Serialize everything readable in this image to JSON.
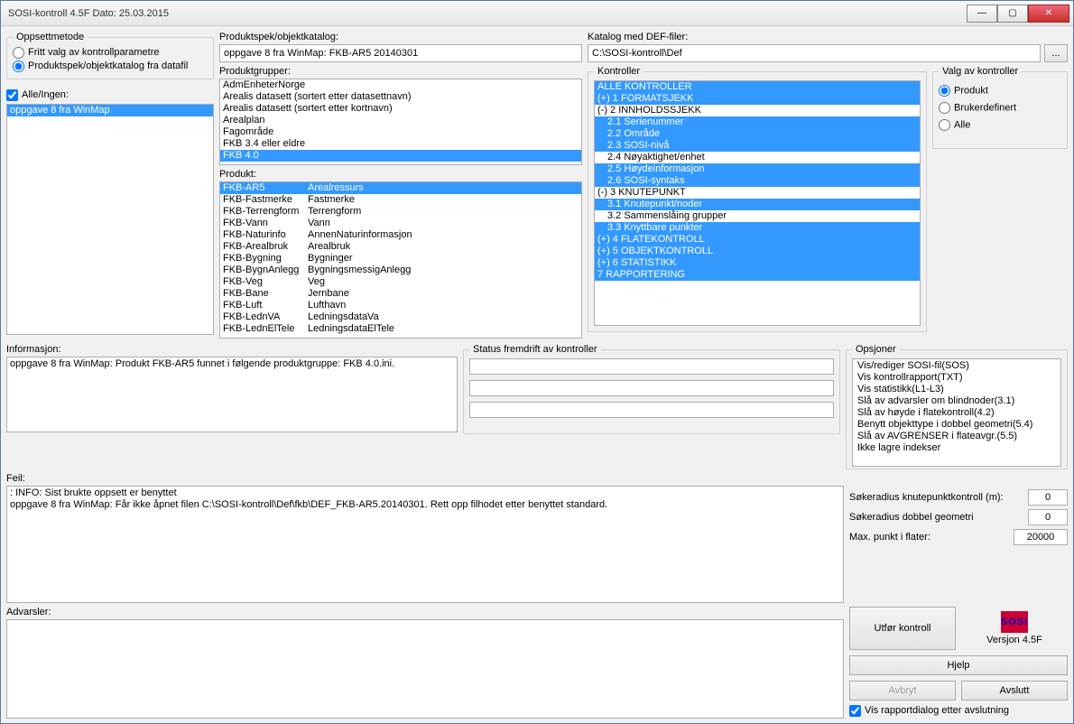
{
  "titlebar": "SOSI-kontroll 4.5F   Dato: 25.03.2015",
  "oppsett": {
    "legend": "Oppsettmetode",
    "r1": "Fritt valg av kontrollparametre",
    "r2": "Produktspek/objektkatalog fra datafil"
  },
  "alleIngen": {
    "label": "Alle/Ingen:",
    "items": [
      "oppgave 8 fra WinMap"
    ]
  },
  "ps": {
    "label": "Produktspek/objektkatalog:",
    "value": "oppgave 8 fra WinMap: FKB-AR5 20140301",
    "grupper_label": "Produktgrupper:",
    "grupper": [
      {
        "t": "AdmEnheterNorge",
        "sel": false
      },
      {
        "t": "Arealis datasett (sortert etter datasettnavn)",
        "sel": false
      },
      {
        "t": "Arealis datasett (sortert etter kortnavn)",
        "sel": false
      },
      {
        "t": "Arealplan",
        "sel": false
      },
      {
        "t": "Fagområde",
        "sel": false
      },
      {
        "t": "FKB 3.4 eller eldre",
        "sel": false
      },
      {
        "t": "FKB 4.0",
        "sel": true
      }
    ],
    "produkt_label": "Produkt:",
    "produkt": [
      {
        "a": "FKB-AR5",
        "b": "Arealressurs",
        "sel": true
      },
      {
        "a": "FKB-Fastmerke",
        "b": "Fastmerke",
        "sel": false
      },
      {
        "a": "FKB-Terrengform",
        "b": "Terrengform",
        "sel": false
      },
      {
        "a": "FKB-Vann",
        "b": "Vann",
        "sel": false
      },
      {
        "a": "FKB-Naturinfo",
        "b": "AnnenNaturinformasjon",
        "sel": false
      },
      {
        "a": "FKB-Arealbruk",
        "b": "Arealbruk",
        "sel": false
      },
      {
        "a": "FKB-Bygning",
        "b": "Bygninger",
        "sel": false
      },
      {
        "a": "FKB-BygnAnlegg",
        "b": "BygningsmessigAnlegg",
        "sel": false
      },
      {
        "a": "FKB-Veg",
        "b": "Veg",
        "sel": false
      },
      {
        "a": "FKB-Bane",
        "b": "Jernbane",
        "sel": false
      },
      {
        "a": "FKB-Luft",
        "b": "Lufthavn",
        "sel": false
      },
      {
        "a": "FKB-LednVA",
        "b": "LedningsdataVa",
        "sel": false
      },
      {
        "a": "FKB-LednElTele",
        "b": "LedningsdataElTele",
        "sel": false
      }
    ]
  },
  "def": {
    "label": "Katalog med DEF-filer:",
    "value": "C:\\SOSI-kontroll\\Def",
    "browse": "..."
  },
  "kontroller": {
    "legend": "Kontroller",
    "items": [
      {
        "t": "ALLE KONTROLLER",
        "sel": true,
        "ind": 0
      },
      {
        "t": "(+) 1 FORMATSJEKK",
        "sel": true,
        "ind": 0
      },
      {
        "t": "(-) 2 INNHOLDSSJEKK",
        "sel": false,
        "ind": 0
      },
      {
        "t": "2.1 Serienummer",
        "sel": true,
        "ind": 1
      },
      {
        "t": "2.2 Område",
        "sel": true,
        "ind": 1
      },
      {
        "t": "2.3 SOSI-nivå",
        "sel": true,
        "ind": 1
      },
      {
        "t": "2.4 Nøyaktighet/enhet",
        "sel": false,
        "ind": 1
      },
      {
        "t": "2.5 Høydeinformasjon",
        "sel": true,
        "ind": 1
      },
      {
        "t": "2.6 SOSI-syntaks",
        "sel": true,
        "ind": 1
      },
      {
        "t": "(-) 3 KNUTEPUNKT",
        "sel": false,
        "ind": 0
      },
      {
        "t": "3.1 Knutepunkt/noder",
        "sel": true,
        "ind": 1
      },
      {
        "t": "3.2 Sammenslåing grupper",
        "sel": false,
        "ind": 1
      },
      {
        "t": "3.3 Knyttbare punkter",
        "sel": true,
        "ind": 1
      },
      {
        "t": "(+) 4 FLATEKONTROLL",
        "sel": true,
        "ind": 0
      },
      {
        "t": "(+) 5 OBJEKTKONTROLL",
        "sel": true,
        "ind": 0
      },
      {
        "t": "(+) 6 STATISTIKK",
        "sel": true,
        "ind": 0
      },
      {
        "t": "7 RAPPORTERING",
        "sel": true,
        "ind": 0
      }
    ]
  },
  "valg": {
    "legend": "Valg av kontroller",
    "r1": "Produkt",
    "r2": "Brukerdefinert",
    "r3": "Alle"
  },
  "info": {
    "label": "Informasjon:",
    "text": "oppgave 8 fra WinMap: Produkt FKB-AR5 funnet i følgende produktgruppe: FKB 4.0.ini."
  },
  "status": {
    "legend": "Status fremdrift av kontroller"
  },
  "opsjoner": {
    "legend": "Opsjoner",
    "items": [
      "Vis/rediger SOSI-fil(SOS)",
      "Vis kontrollrapport(TXT)",
      "Vis statistikk(L1-L3)",
      "Slå av advarsler om blindnoder(3.1)",
      "Slå av høyde i flatekontroll(4.2)",
      "Benytt objekttype i dobbel geometri(5.4)",
      "Slå av AVGRENSER i flateavgr.(5.5)",
      "Ikke lagre indekser"
    ]
  },
  "feil": {
    "label": "Feil:",
    "l1": ": INFO: Sist brukte oppsett er benyttet",
    "l2": "oppgave 8 fra WinMap: Får ikke åpnet filen C:\\SOSI-kontroll\\Def\\fkb\\DEF_FKB-AR5.20140301. Rett opp filhodet etter benyttet standard."
  },
  "adv": {
    "label": "Advarsler:"
  },
  "nums": {
    "l1": "Søkeradius knutepunktkontroll (m):",
    "v1": "0",
    "l2": "Søkeradius dobbel geometri",
    "v2": "0",
    "l3": "Max. punkt i flater:",
    "v3": "20000"
  },
  "btns": {
    "utfor": "Utfør kontroll",
    "versjon": "Versjon 4.5F",
    "hjelp": "Hjelp",
    "avbryt": "Avbryt",
    "avslutt": "Avslutt",
    "logo": "SOSI"
  },
  "chk": "Vis rapportdialog etter avslutning"
}
